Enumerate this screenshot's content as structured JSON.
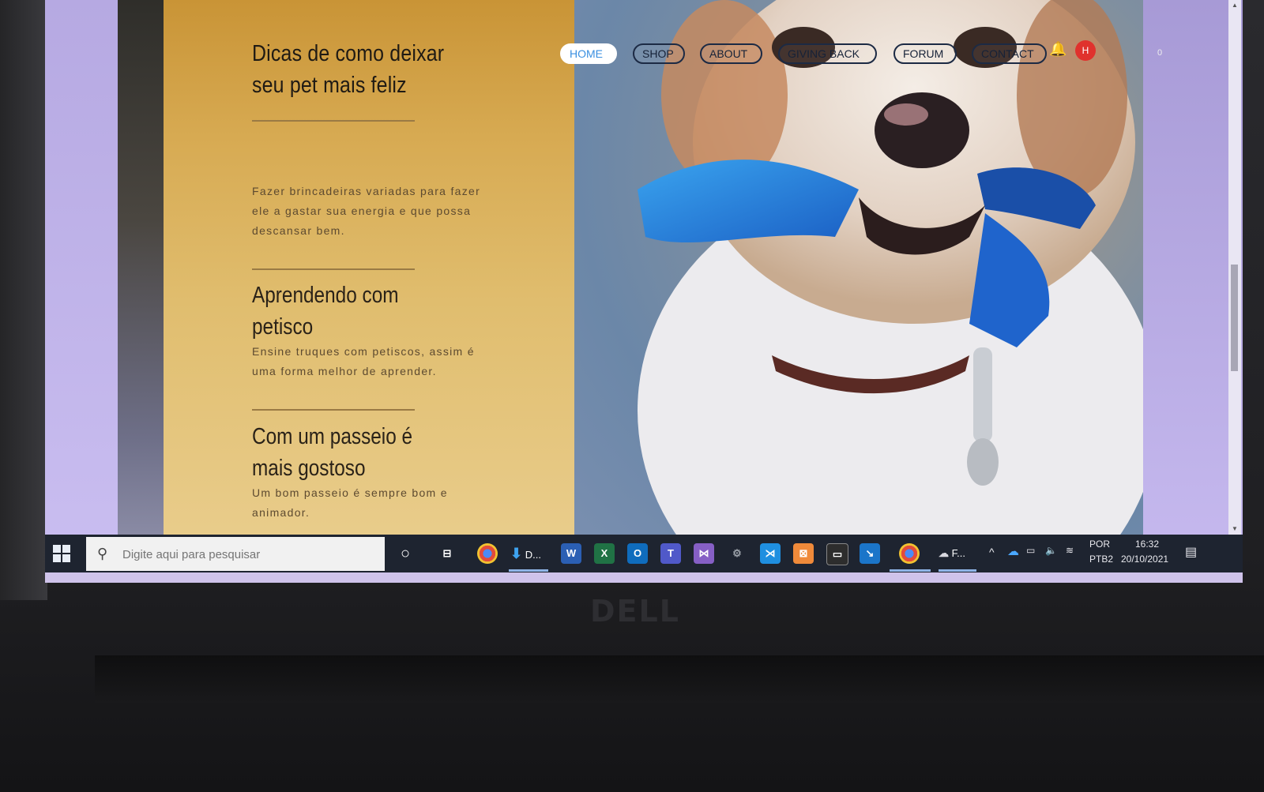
{
  "nav": {
    "items": [
      "HOME",
      "SHOP",
      "ABOUT",
      "GIVING BACK",
      "FORUM",
      "CONTACT"
    ],
    "active": "HOME",
    "avatar_initial": "H",
    "cart_count": "0"
  },
  "content": {
    "title": "Dicas de como deixar seu pet mais feliz",
    "intro": "Fazer brincadeiras variadas para fazer ele a gastar sua energia e que possa descansar bem.",
    "section1_title": "Aprendendo com petisco",
    "section1_text": "Ensine truques com petiscos, assim é uma forma melhor de aprender.",
    "section2_title": "Com um passeio é mais gostoso",
    "section2_text": "Um bom passeio é sempre bom e animador."
  },
  "taskbar": {
    "search_placeholder": "Digite aqui para pesquisar",
    "downloads_label": "D...",
    "file_explorer_label": "F...",
    "language": "POR",
    "keyboard": "PTB2",
    "time": "16:32",
    "date": "20/10/2021"
  },
  "hardware": {
    "brand": "DELL"
  }
}
